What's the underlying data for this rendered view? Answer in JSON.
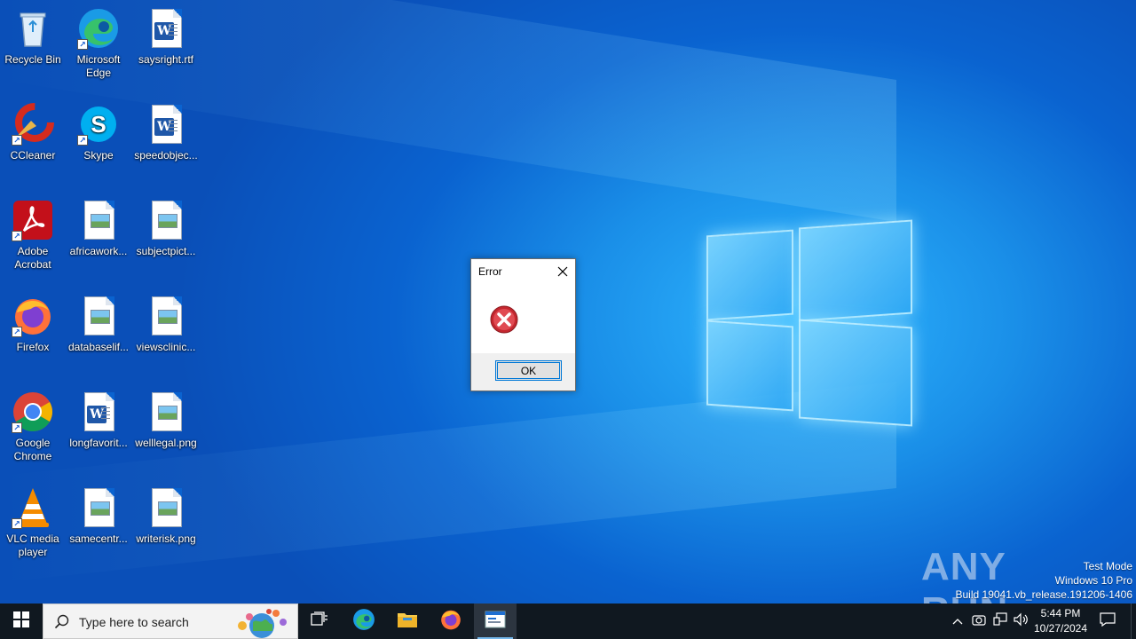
{
  "desktop": {
    "icons": [
      {
        "label": "Recycle Bin",
        "icon": "recycle-bin-icon"
      },
      {
        "label": "Microsoft Edge",
        "icon": "edge-icon"
      },
      {
        "label": "saysright.rtf",
        "icon": "word-document-icon"
      },
      {
        "label": "CCleaner",
        "icon": "ccleaner-icon"
      },
      {
        "label": "Skype",
        "icon": "skype-icon"
      },
      {
        "label": "speedobjec...",
        "icon": "word-document-icon"
      },
      {
        "label": "Adobe Acrobat",
        "icon": "acrobat-icon"
      },
      {
        "label": "africawork...",
        "icon": "image-file-icon"
      },
      {
        "label": "subjectpict...",
        "icon": "image-file-icon"
      },
      {
        "label": "Firefox",
        "icon": "firefox-icon"
      },
      {
        "label": "databaselif...",
        "icon": "image-file-icon"
      },
      {
        "label": "viewsclinic...",
        "icon": "image-file-icon"
      },
      {
        "label": "Google Chrome",
        "icon": "chrome-icon"
      },
      {
        "label": "longfavorit...",
        "icon": "word-document-icon"
      },
      {
        "label": "welllegal.png",
        "icon": "image-file-icon"
      },
      {
        "label": "VLC media player",
        "icon": "vlc-icon"
      },
      {
        "label": "samecentr...",
        "icon": "image-file-icon"
      },
      {
        "label": "writerisk.png",
        "icon": "image-file-icon"
      }
    ]
  },
  "dialog": {
    "title": "Error",
    "ok_label": "OK",
    "icon": "error-icon"
  },
  "watermark": {
    "brand": "ANY RUN"
  },
  "os_info": {
    "line1": "Test Mode",
    "line2": "Windows 10 Pro",
    "line3": "Build 19041.vb_release.191206-1406"
  },
  "taskbar": {
    "search_placeholder": "Type here to search",
    "time": "5:44 PM",
    "date": "10/27/2024",
    "accent": "#76b9ed"
  }
}
